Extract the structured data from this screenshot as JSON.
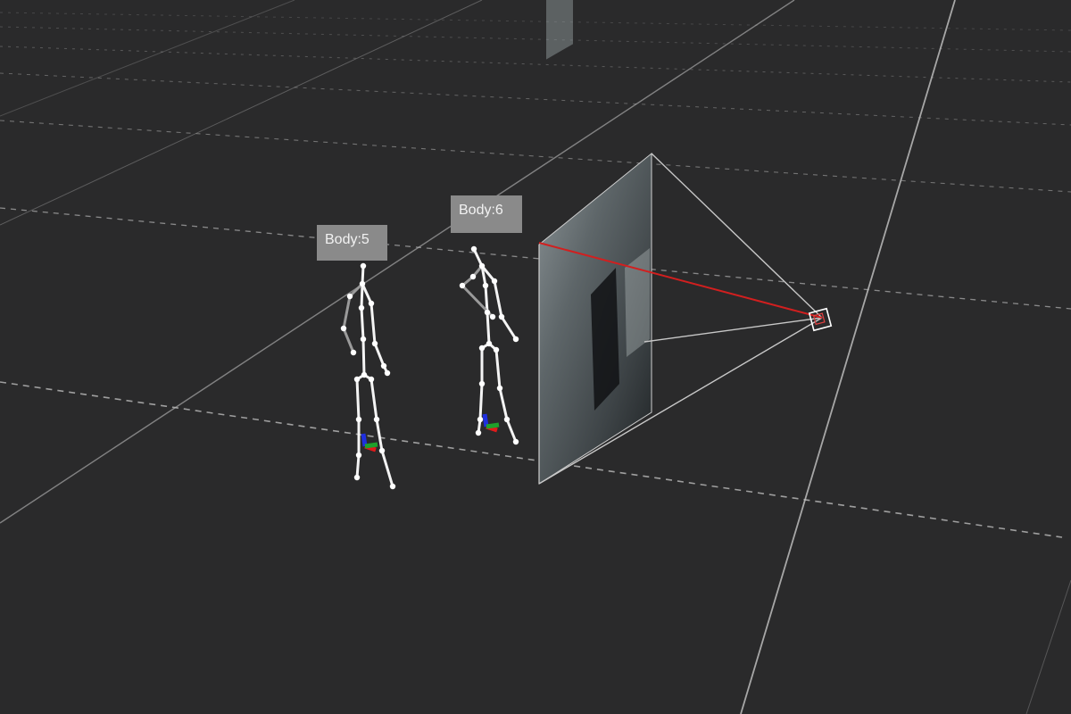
{
  "viewport": {
    "background_color": "#2a2a2b",
    "grid_color": "#bdbdbd"
  },
  "bodies": [
    {
      "label": "Body:5"
    },
    {
      "label": "Body:6"
    }
  ],
  "camera": {
    "icon": "camera-frustum-icon",
    "ray_color": "#d21f1f"
  },
  "joint_axes": {
    "x_color": "#e01b1b",
    "y_color": "#1fa12b",
    "z_color": "#1f2fe0"
  }
}
